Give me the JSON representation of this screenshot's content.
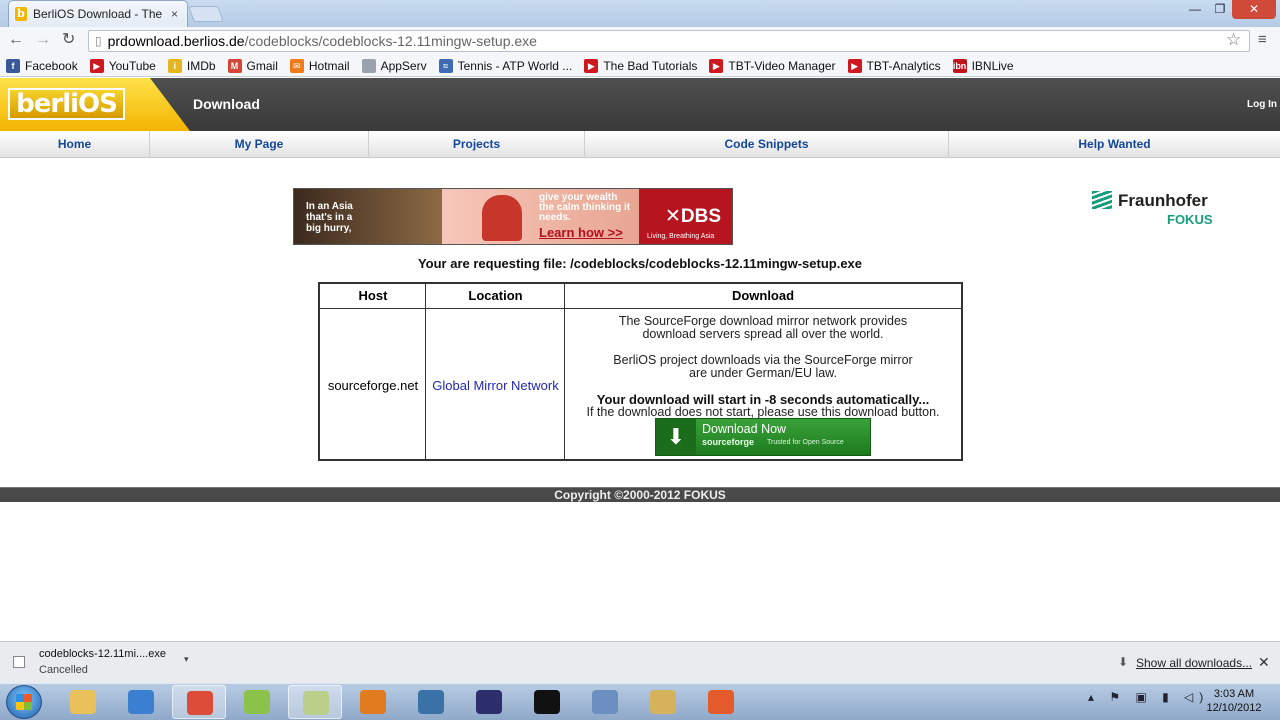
{
  "browser": {
    "tab_title": "BerliOS Download - The O",
    "tab_close": "×",
    "url_host": "prdownload.berlios.de",
    "url_path": "/codeblocks/codeblocks-12.11mingw-setup.exe",
    "window_controls": {
      "minimize": "—",
      "maximize": "❐",
      "close": "✕"
    },
    "nav": {
      "back": "←",
      "forward": "→",
      "reload": "↻",
      "star": "☆",
      "menu": "≡"
    }
  },
  "bookmarks": [
    {
      "label": "Facebook",
      "icon": "facebook-icon",
      "color": "#3b5998",
      "glyph": "f"
    },
    {
      "label": "YouTube",
      "icon": "youtube-icon",
      "color": "#cc181e",
      "glyph": "▶"
    },
    {
      "label": "IMDb",
      "icon": "imdb-icon",
      "color": "#e4b722",
      "glyph": "i"
    },
    {
      "label": "Gmail",
      "icon": "gmail-icon",
      "color": "#d44638",
      "glyph": "M"
    },
    {
      "label": "Hotmail",
      "icon": "hotmail-icon",
      "color": "#f07b1a",
      "glyph": "✉"
    },
    {
      "label": "AppServ",
      "icon": "page-icon",
      "color": "#9aa3ad",
      "glyph": ""
    },
    {
      "label": "Tennis - ATP World ...",
      "icon": "atp-icon",
      "color": "#3e6bb4",
      "glyph": "≈"
    },
    {
      "label": "The Bad Tutorials",
      "icon": "youtube-icon",
      "color": "#cc181e",
      "glyph": "▶"
    },
    {
      "label": "TBT-Video Manager",
      "icon": "youtube-icon",
      "color": "#cc181e",
      "glyph": "▶"
    },
    {
      "label": "TBT-Analytics",
      "icon": "youtube-icon",
      "color": "#cc181e",
      "glyph": "▶"
    },
    {
      "label": "IBNLive",
      "icon": "ibnlive-icon",
      "color": "#c0141b",
      "glyph": "ibn"
    }
  ],
  "site": {
    "logo_text": "berliOS",
    "section_title": "Download",
    "login": "Log In",
    "nav": [
      "Home",
      "My Page",
      "Projects",
      "Code Snippets",
      "Help Wanted"
    ]
  },
  "ad": {
    "left_text": "In an Asia that's in a big hurry,",
    "middle_text": "give your wealth the calm thinking it needs.",
    "cta": "Learn how >>",
    "brand": "✕DBS",
    "tagline": "Living, Breathing Asia"
  },
  "sponsor": {
    "name": "Fraunhofer",
    "sub": "FOKUS"
  },
  "request_line": "Your are requesting file: /codeblocks/codeblocks-12.11mingw-setup.exe",
  "table": {
    "headers": [
      "Host",
      "Location",
      "Download"
    ],
    "host": "sourceforge.net",
    "location": "Global Mirror Network",
    "para1_line1": "The SourceForge download mirror network provides",
    "para1_line2": "download servers spread all over the world.",
    "para2_line1": "BerliOS project downloads via the SourceForge mirror",
    "para2_line2": "are under German/EU law.",
    "countdown": "Your download will start in -8 seconds automatically...",
    "fallback": "If the download does not start, please use this download button.",
    "button_label": "Download Now",
    "button_brand": "sourceforge",
    "button_tag": "Trusted for Open Source"
  },
  "footer": "Copyright ©2000-2012 FOKUS",
  "downloads": {
    "file": "codeblocks-12.11mi....exe",
    "status": "Cancelled",
    "show_all": "Show all downloads...",
    "close": "✕"
  },
  "taskbar": {
    "apps": [
      {
        "name": "explorer-icon",
        "color": "#e8c15a"
      },
      {
        "name": "itunes-icon",
        "color": "#3b7fd0"
      },
      {
        "name": "chrome-icon",
        "color": "#dd4b39"
      },
      {
        "name": "notepadpp-icon",
        "color": "#8bc34a"
      },
      {
        "name": "app-icon",
        "color": "#b9cf8a"
      },
      {
        "name": "word-icon",
        "color": "#e07b20"
      },
      {
        "name": "python-icon",
        "color": "#3a72a8"
      },
      {
        "name": "eclipse-icon",
        "color": "#2c2f6b"
      },
      {
        "name": "cmd-icon",
        "color": "#111111"
      },
      {
        "name": "database-icon",
        "color": "#6a8fc0"
      },
      {
        "name": "tools-icon",
        "color": "#d6b25a"
      },
      {
        "name": "winlogo-icon",
        "color": "#e35b2a"
      }
    ],
    "time": "3:03 AM",
    "date": "12/10/2012"
  }
}
